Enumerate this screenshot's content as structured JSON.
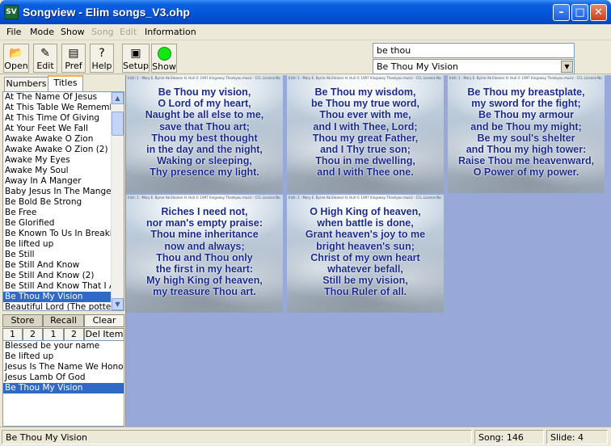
{
  "window": {
    "title": "Songview - Elim songs_V3.ohp",
    "icon_label": "SV"
  },
  "menu": {
    "items": [
      {
        "label": "File",
        "enabled": true
      },
      {
        "label": "Mode",
        "enabled": true
      },
      {
        "label": "Show",
        "enabled": true
      },
      {
        "label": "Song",
        "enabled": false
      },
      {
        "label": "Edit",
        "enabled": false
      },
      {
        "label": "Information",
        "enabled": true
      }
    ]
  },
  "toolbar": {
    "open_label": "Open",
    "edit_label": "Edit",
    "pref_label": "Pref",
    "help_label": "Help",
    "setup_label": "Setup",
    "show_label": "Show",
    "show_indicator_color": "#12e812"
  },
  "search": {
    "value": "be thou"
  },
  "song_select": {
    "selected": "Be Thou My Vision"
  },
  "tabs": {
    "numbers": "Numbers",
    "titles": "Titles",
    "active": "titles"
  },
  "titles_list": [
    "At The Name Of Jesus",
    "At This Table We Remember",
    "At This Time Of Giving",
    "At Your Feet We Fall",
    "Awake Awake O Zion",
    "Awake Awake O Zion (2)",
    "Awake My Eyes",
    "Awake My Soul",
    "Away In A Manger",
    "Baby Jesus In The Manger",
    "Be Bold Be Strong",
    "Be Free",
    "Be Glorified",
    "Be Known To Us In Breaking",
    "Be lifted up",
    "Be Still",
    "Be Still And Know",
    "Be Still And Know (2)",
    "Be Still And Know That I Am",
    "Be Thou My Vision",
    "Beautiful Lord (The potters"
  ],
  "titles_selected_index": 19,
  "store_panel": {
    "store_label": "Store",
    "recall_label": "Recall",
    "clear_label": "Clear",
    "store1": "1",
    "store2": "2",
    "recall1": "1",
    "recall2": "2",
    "del_label": "Del Item"
  },
  "recall_list": [
    "Blessed be your name",
    "Be lifted up",
    "Jesus Is The Name We Honour",
    "Jesus Lamb Of God",
    "Be Thou My Vision"
  ],
  "recall_selected_index": 4,
  "slides": [
    {
      "credit": "Irish: 1 · Mary E. Byrne Ab Eleanor H. Hull © 1997 Kingsway Thankyou music · CCL Licence No 37663",
      "lines": [
        "Be Thou my vision,",
        "O Lord of my heart,",
        "Naught be all else to me,",
        "save that Thou art;",
        "Thou my best thought",
        "in the day and the night,",
        "Waking or sleeping,",
        "Thy presence my light."
      ]
    },
    {
      "credit": "Irish: 1 · Mary E. Byrne Ab Eleanor H. Hull © 1997 Kingsway Thankyou music · CCL Licence No 37663",
      "lines": [
        "Be Thou my wisdom,",
        "be Thou my true word,",
        "Thou ever with me,",
        "and I with Thee, Lord;",
        "Thou my great Father,",
        "and I Thy true son;",
        "Thou in me dwelling,",
        "and I with Thee one."
      ]
    },
    {
      "credit": "Irish: 1 · Mary E. Byrne Ab Eleanor H. Hull © 1997 Kingsway Thankyou music · CCL Licence No 37663",
      "lines": [
        "Be Thou my breastplate,",
        "my sword for the fight;",
        "Be Thou my armour",
        "and be Thou my might;",
        "Be my soul's shelter",
        "and Thou my high tower:",
        "Raise Thou me heavenward,",
        "O Power of my power."
      ]
    },
    {
      "credit": "Irish: 1 · Mary E. Byrne Ab Eleanor H. Hull © 1997 Kingsway Thankyou music · CCL Licence No 37663",
      "lines": [
        "Riches I need not,",
        "nor man's empty praise:",
        "Thou mine inheritance",
        "now and always;",
        "Thou and Thou only",
        "the first in my heart:",
        "My high King of heaven,",
        "my treasure Thou art."
      ]
    },
    {
      "credit": "Irish: 1 · Mary E. Byrne Ab Eleanor H. Hull © 1997 Kingsway Thankyou music · CCL Licence No 37663",
      "lines": [
        "O High King of heaven,",
        "when battle is done,",
        "Grant heaven's joy to me",
        "bright heaven's sun;",
        "Christ of my own heart",
        "whatever befall,",
        "Still be my vision,",
        "Thou Ruler of all."
      ]
    }
  ],
  "status": {
    "song_title": "Be Thou My Vision",
    "song_number": "Song: 146",
    "slide_number": "Slide: 4"
  }
}
